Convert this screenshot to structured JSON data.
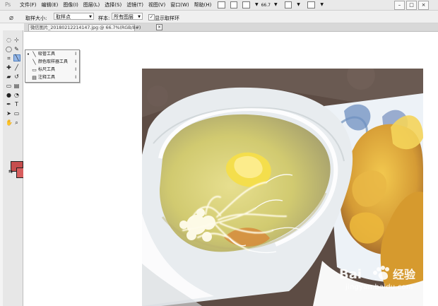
{
  "app": {
    "logo": "Ps"
  },
  "menus": [
    "文件(F)",
    "编辑(E)",
    "图像(I)",
    "图层(L)",
    "选择(S)",
    "滤镜(T)",
    "视图(V)",
    "窗口(W)",
    "帮助(H)"
  ],
  "toolbar_right": {
    "zoom": "66.7"
  },
  "window_controls": {
    "minimize": "–",
    "restore": "□",
    "close": "×"
  },
  "options": {
    "sample_size_label": "取样大小:",
    "sample_size_value": "取样点",
    "sample_label": "样本:",
    "sample_value": "所有图层",
    "checkbox_label": "显示取样环",
    "checkbox_checked": true
  },
  "document": {
    "tab_title": "微信图片_20180212214147.jpg @ 66.7%(RGB/8#)",
    "close": "×"
  },
  "flyout": {
    "items": [
      {
        "label": "吸管工具",
        "shortcut": "I",
        "selected": true
      },
      {
        "label": "颜色取样器工具",
        "shortcut": "I",
        "selected": false
      },
      {
        "label": "标尺工具",
        "shortcut": "I",
        "selected": false
      },
      {
        "label": "注释工具",
        "shortcut": "I",
        "selected": false
      }
    ]
  },
  "colors": {
    "foreground": "#c64d4d",
    "background": "#d75e5e",
    "active_tool": "#95b7e8"
  },
  "watermark": {
    "logo_text": "Bai",
    "logo_text_2": "经验",
    "url": "jingyan.baidu.com"
  }
}
